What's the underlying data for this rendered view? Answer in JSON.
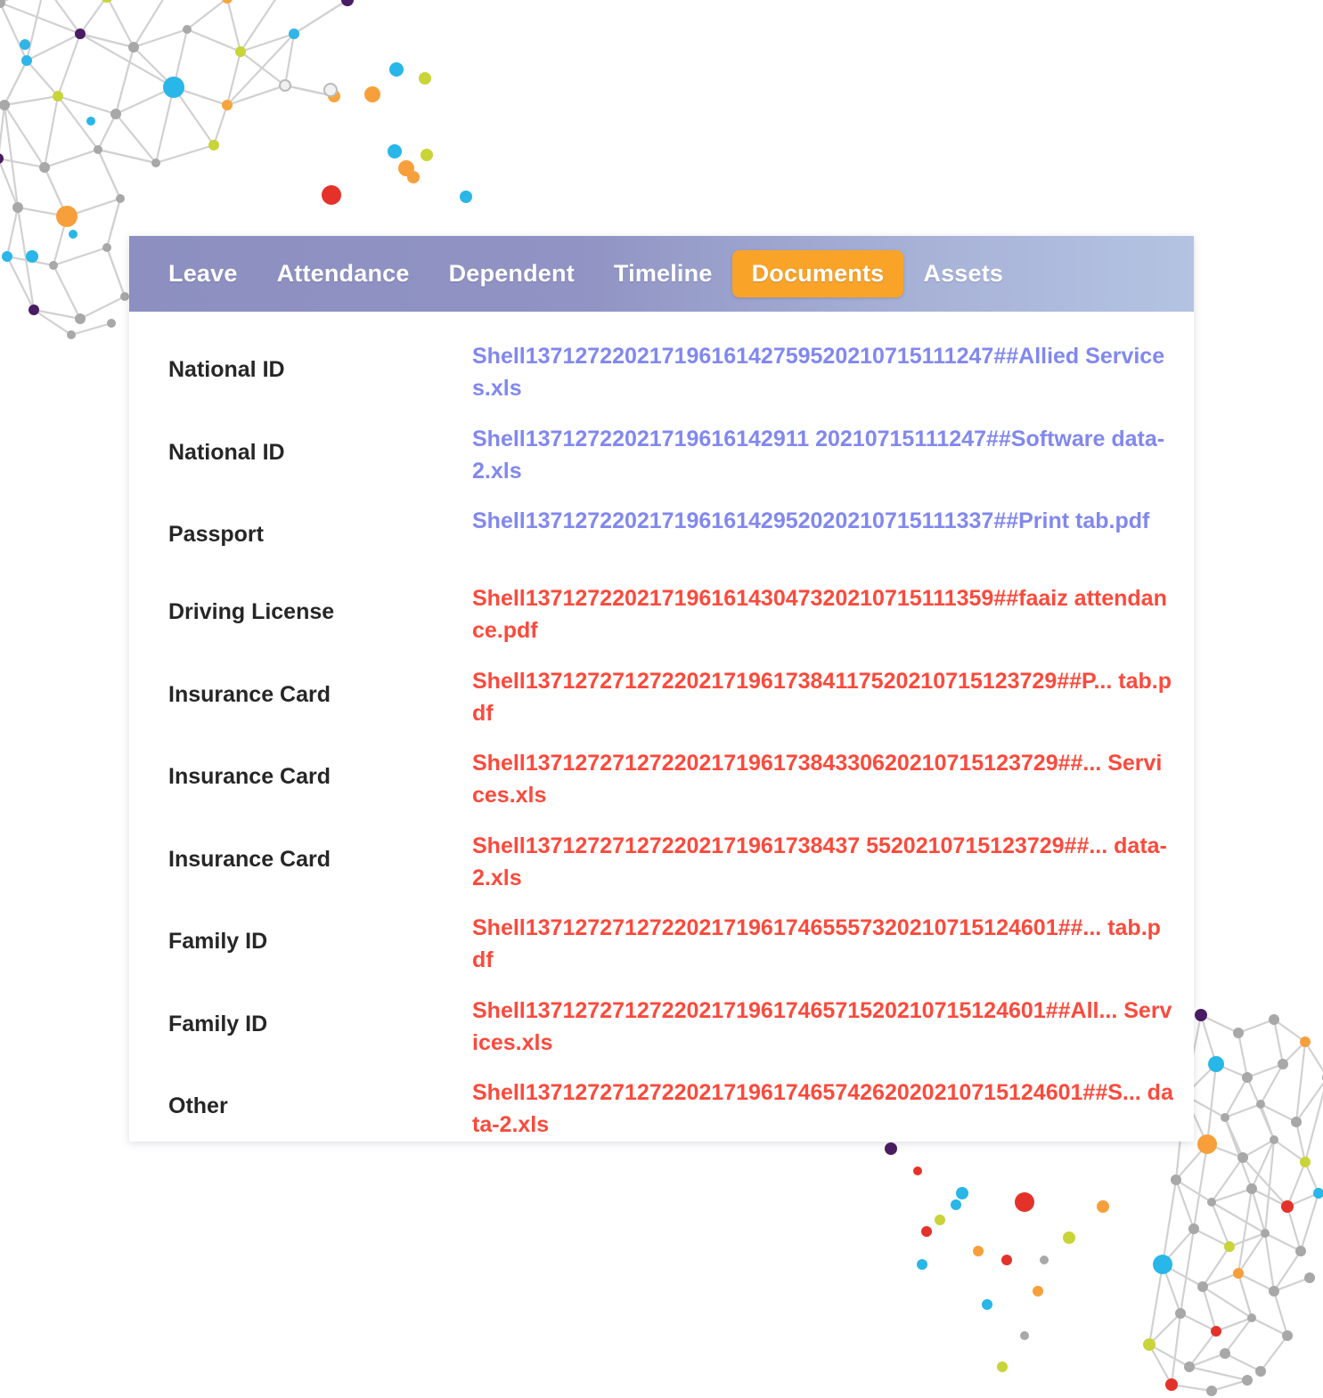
{
  "tabs": [
    {
      "label": "Leave",
      "active": false
    },
    {
      "label": "Attendance",
      "active": false
    },
    {
      "label": "Dependent",
      "active": false
    },
    {
      "label": "Timeline",
      "active": false
    },
    {
      "label": "Documents",
      "active": true
    },
    {
      "label": "Assets",
      "active": false
    }
  ],
  "colors": {
    "tabbar_left": "#8c8fc0",
    "tabbar_right": "#b4c3e2",
    "active_tab": "#f9a428",
    "link_violet": "#8188ee",
    "link_red": "#fb4a3c",
    "type_text": "#262626",
    "card_background": "#ffffff"
  },
  "documents": [
    {
      "type": "National ID",
      "filename": "Shell13712722021719616142759520210715111247##Allied Services.xls",
      "color": "violet"
    },
    {
      "type": "National ID",
      "filename": "Shell13712722021719616142911 20210715111247##Software data-2.xls",
      "color": "violet"
    },
    {
      "type": "Passport",
      "filename": "Shell13712722021719616142952020210715111337##Print tab.pdf",
      "color": "violet"
    },
    {
      "type": "Driving License",
      "filename": "Shell13712722021719616143047320210715111359##faaiz attendance.pdf",
      "color": "red"
    },
    {
      "type": "Insurance Card",
      "filename": "Shell1371272712722021719617384117520210715123729##P... tab.pdf",
      "color": "red"
    },
    {
      "type": "Insurance Card",
      "filename": "Shell1371272712722021719617384330620210715123729##... Services.xls",
      "color": "red"
    },
    {
      "type": "Insurance Card",
      "filename": "Shell137127271272202171961738437 5520210715123729##... data-2.xls",
      "color": "red"
    },
    {
      "type": "Family ID",
      "filename": "Shell1371272712722021719617465557320210715124601##... tab.pdf",
      "color": "red"
    },
    {
      "type": "Family ID",
      "filename": "Shell137127271272202171961746571520210715124601##All... Services.xls",
      "color": "red"
    },
    {
      "type": "Other",
      "filename": "Shell137127271272202171961746574262020210715124601##S... data-2.xls",
      "color": "red"
    }
  ],
  "decoration": {
    "top_left_graphic": "network-graph-decoration",
    "bottom_right_graphic": "network-graph-decoration"
  }
}
